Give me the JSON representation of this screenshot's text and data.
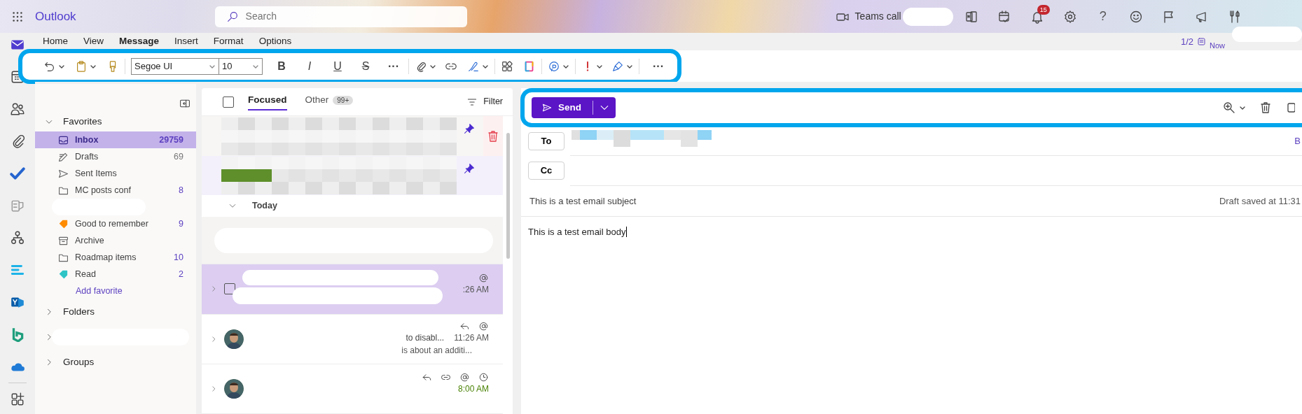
{
  "header": {
    "app_name": "Outlook",
    "search_placeholder": "Search",
    "teams_call": "Teams call",
    "notification_count": "15",
    "help": "?"
  },
  "ribbon_tabs": [
    {
      "label": "Home",
      "selected": false
    },
    {
      "label": "View",
      "selected": false
    },
    {
      "label": "Message",
      "selected": true
    },
    {
      "label": "Insert",
      "selected": false
    },
    {
      "label": "Format",
      "selected": false
    },
    {
      "label": "Options",
      "selected": false
    }
  ],
  "pager": {
    "position": "1/2",
    "time": "Now"
  },
  "toolbar": {
    "font": "Segoe UI",
    "size": "10",
    "format_buttons": [
      {
        "label": "B",
        "kind": "bold"
      },
      {
        "label": "I",
        "kind": "italic"
      },
      {
        "label": "U",
        "kind": "underline"
      },
      {
        "label": "S",
        "kind": "strike"
      }
    ],
    "more": "···",
    "more_end": "···"
  },
  "folders": {
    "favorites": {
      "label": "Favorites",
      "expanded": true
    },
    "items": [
      {
        "kind": "inbox",
        "label": "Inbox",
        "count": "29759",
        "unread": true,
        "selected": true
      },
      {
        "kind": "drafts",
        "label": "Drafts",
        "count": "69",
        "unread": false,
        "selected": false
      },
      {
        "kind": "sent",
        "label": "Sent Items",
        "selected": false
      },
      {
        "kind": "folder",
        "label": "MC posts conf",
        "count": "8",
        "unread": true,
        "selected": false
      },
      {
        "kind": "redacted"
      },
      {
        "kind": "category",
        "label": "Good to remember",
        "count": "9",
        "unread": true,
        "color": "#ff8c00",
        "selected": false
      },
      {
        "kind": "archive",
        "label": "Archive",
        "selected": false
      },
      {
        "kind": "folder",
        "label": "Roadmap items",
        "count": "10",
        "unread": true,
        "selected": false
      },
      {
        "kind": "category",
        "label": "Read",
        "count": "2",
        "unread": true,
        "color": "#2ec4c6",
        "selected": false
      }
    ],
    "add_favorite": "Add favorite",
    "sections": [
      {
        "label": "Folders",
        "expanded": false
      },
      {
        "kind": "redacted",
        "expanded": false
      },
      {
        "label": "Groups",
        "expanded": false
      }
    ]
  },
  "message_list": {
    "select_all": {
      "checked": false
    },
    "tabs": [
      {
        "label": "Focused",
        "selected": true
      },
      {
        "label": "Other",
        "selected": false,
        "badge": "99+"
      }
    ],
    "filter": "Filter",
    "group_label": "Today",
    "messages": [
      {
        "kind": "pinned",
        "hovered": true
      },
      {
        "kind": "pinned",
        "hovered": false
      },
      {
        "kind": "redacted"
      },
      {
        "kind": "mail",
        "selected": true,
        "checked": false,
        "avatar": false,
        "time": ":26 AM",
        "replied": false,
        "has_link": false,
        "mentioned": true,
        "reminder": false
      },
      {
        "kind": "mail",
        "selected": false,
        "avatar": true,
        "subject": "to disabl...",
        "time": "11:26 AM",
        "preview": "is about an additi...",
        "replied": true,
        "has_link": false,
        "mentioned": true,
        "reminder": false
      },
      {
        "kind": "mail",
        "selected": false,
        "avatar": true,
        "time": "8:00 AM",
        "replied": true,
        "has_link": true,
        "mentioned": true,
        "reminder": true
      }
    ]
  },
  "compose": {
    "send": "Send",
    "to_label": "To",
    "cc_label": "Cc",
    "bcc": "B",
    "subject": "This is a test email subject",
    "draft_status": "Draft saved at 11:31",
    "body": "This is a test email body"
  }
}
